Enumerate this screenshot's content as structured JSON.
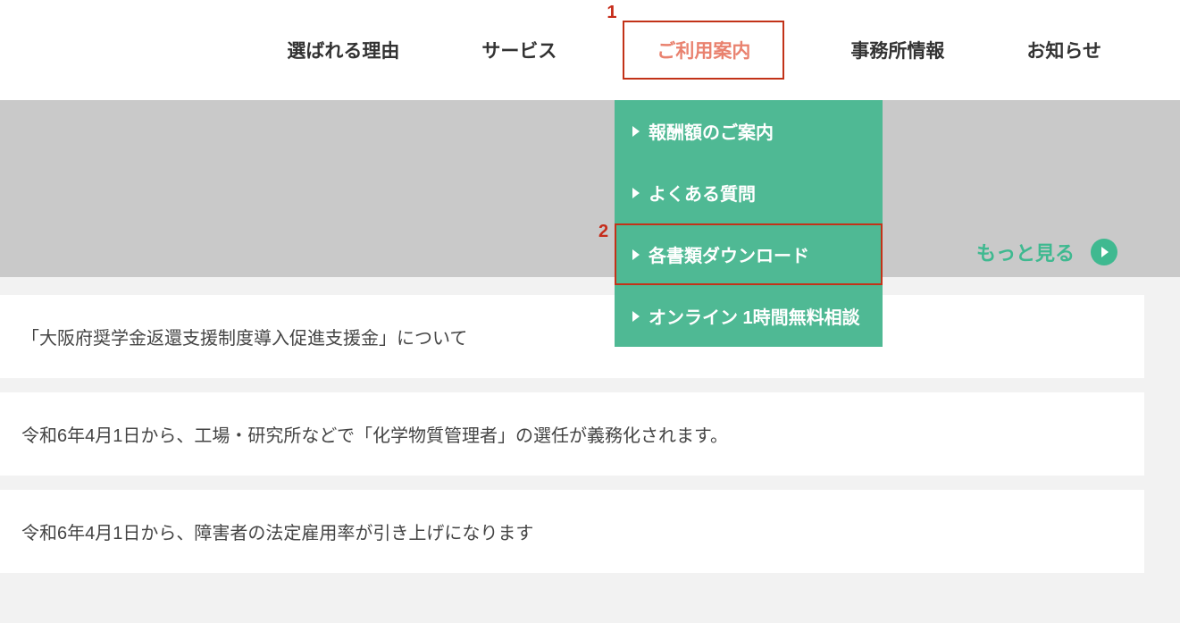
{
  "nav": {
    "items": [
      {
        "label": "選ばれる理由"
      },
      {
        "label": "サービス"
      },
      {
        "label": "ご利用案内",
        "active": true
      },
      {
        "label": "事務所情報"
      },
      {
        "label": "お知らせ"
      }
    ]
  },
  "badges": {
    "one": "1",
    "two": "2"
  },
  "dropdown": {
    "items": [
      {
        "label": "報酬額のご案内"
      },
      {
        "label": "よくある質問"
      },
      {
        "label": "各書類ダウンロード",
        "highlighted": true
      },
      {
        "label": "オンライン 1時間無料相談"
      }
    ]
  },
  "more_link": {
    "label": "もっと見る"
  },
  "news": {
    "items": [
      {
        "title": "「大阪府奨学金返還支援制度導入促進支援金」について"
      },
      {
        "title": "令和6年4月1日から、工場・研究所などで「化学物質管理者」の選任が義務化されます。"
      },
      {
        "title": "令和6年4月1日から、障害者の法定雇用率が引き上げになります"
      }
    ]
  }
}
